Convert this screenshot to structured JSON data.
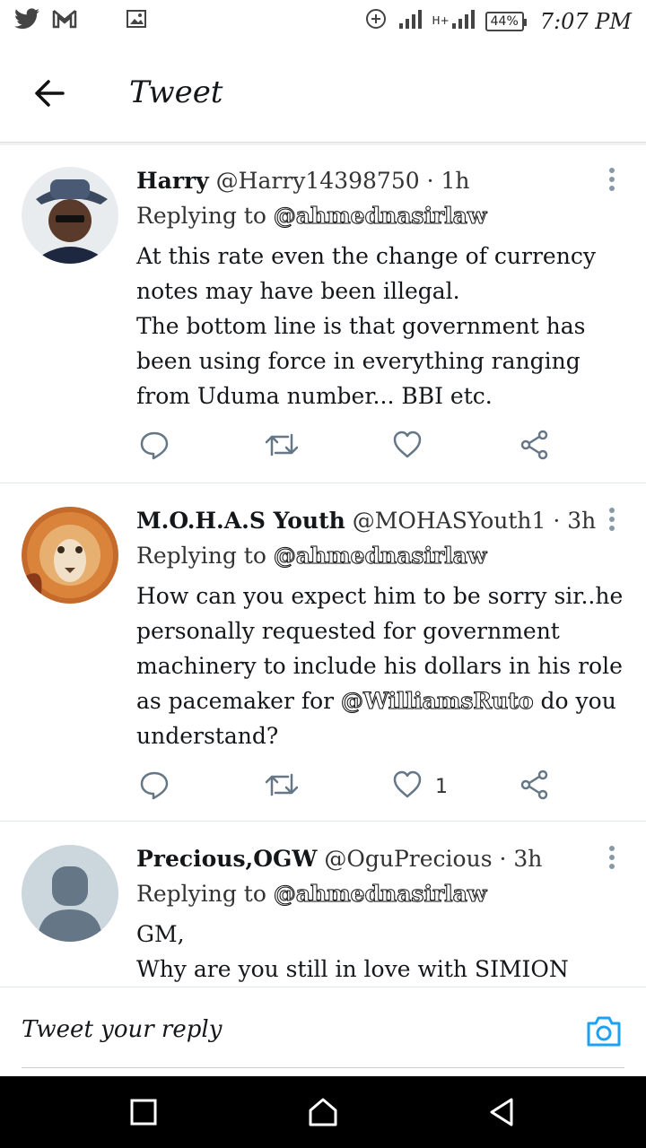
{
  "status_bar": {
    "battery": "44%",
    "time": "7:07 PM",
    "network": "H+"
  },
  "header": {
    "title": "Tweet"
  },
  "tweets": [
    {
      "author": "Harry",
      "handle": "@Harry14398750",
      "time": "· 1h",
      "replying_label": "Replying to",
      "replying_to": "@ahmednasirlaw",
      "text": "At this rate even the change of currency notes may have been illegal.\nThe bottom line is that government has been using force in everything ranging from Uduma number... BBI etc.",
      "likes": ""
    },
    {
      "author": "M.O.H.A.S Youth",
      "handle": "@MOHASYouth1",
      "time": "· 3h",
      "replying_label": "Replying to",
      "replying_to": "@ahmednasirlaw",
      "text_before": "How can you expect him to be sorry sir..he personally requested for government machinery to include his dollars in his role as pacemaker for ",
      "text_mention": "@WilliamsRuto",
      "text_after": "  do you understand?",
      "likes": "1"
    },
    {
      "author": "Precious,OGW",
      "handle": "@OguPrecious",
      "time": "· 3h",
      "replying_label": "Replying to",
      "replying_to": "@ahmednasirlaw",
      "text": "GM,\nWhy are you still in love with SIMION",
      "likes": ""
    }
  ],
  "reply_bar": {
    "placeholder": "Tweet your reply"
  }
}
